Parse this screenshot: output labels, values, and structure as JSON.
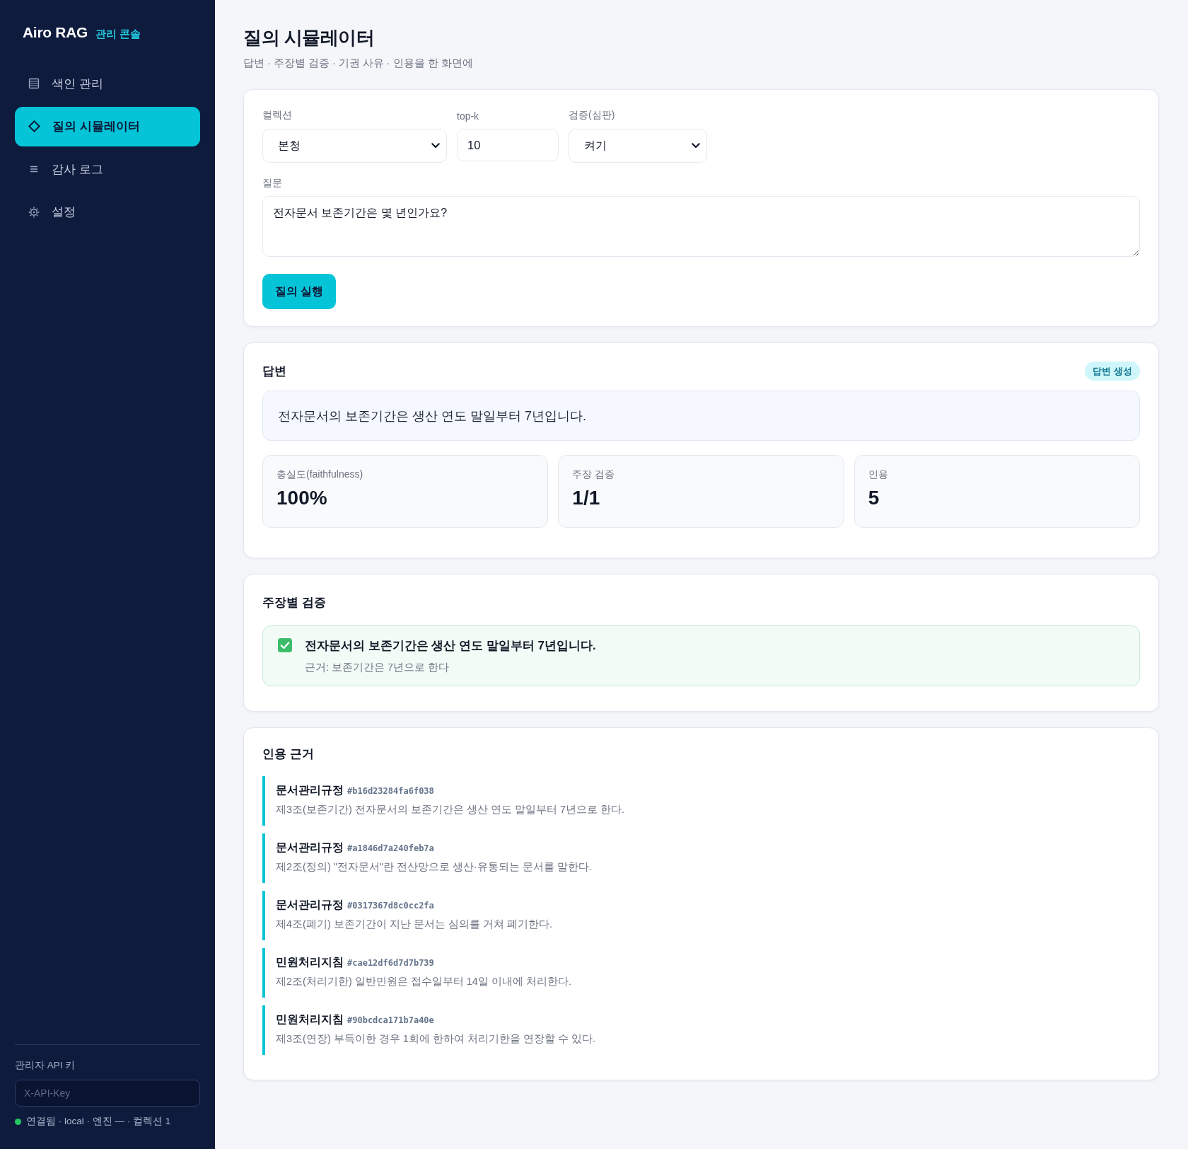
{
  "sidebar": {
    "logo": {
      "name": "Airo RAG",
      "tag": "관리 콘솔"
    },
    "nav": [
      {
        "label": "색인 관리",
        "selected": false
      },
      {
        "label": "질의 시뮬레이터",
        "selected": true
      },
      {
        "label": "감사 로그",
        "selected": false
      },
      {
        "label": "설정",
        "selected": false
      }
    ],
    "api_key": {
      "label": "관리자 API 키",
      "placeholder": "X-API-Key"
    },
    "status": {
      "connected": true,
      "text": "연결됨 · local · 엔진 — · 컬렉션 1"
    }
  },
  "page": {
    "title": "질의 시뮬레이터",
    "subtitle": "답변 · 주장별 검증 · 기권 사유 · 인용을 한 화면에"
  },
  "query_form": {
    "fields": [
      {
        "kind": "select",
        "label": "컬렉션",
        "value": "본청"
      },
      {
        "kind": "number",
        "label": "top-k",
        "value": "10"
      },
      {
        "kind": "select",
        "label": "검증(심판)",
        "value": "켜기"
      }
    ],
    "question": {
      "label": "질문",
      "value": "전자문서 보존기간은 몇 년인가요?"
    },
    "submit": "질의 실행"
  },
  "answer": {
    "heading": "답변",
    "badge": "답변 생성",
    "text": "전자문서의 보존기간은 생산 연도 말일부터 7년입니다.",
    "stats": [
      {
        "label": "충실도(faithfulness)",
        "value": "100%"
      },
      {
        "label": "주장 검증",
        "value": "1/1"
      },
      {
        "label": "인용",
        "value": "5"
      }
    ]
  },
  "claims": {
    "heading": "주장별 검증",
    "items": [
      {
        "verified": true,
        "text": "전자문서의 보존기간은 생산 연도 말일부터 7년입니다.",
        "evidence": "근거: 보존기간은 7년으로 한다"
      }
    ]
  },
  "citations": {
    "heading": "인용 근거",
    "items": [
      {
        "source": "문서관리규정",
        "hash": "#b16d23284fa6f038",
        "text": "제3조(보존기간) 전자문서의 보존기간은 생산 연도 말일부터 7년으로 한다."
      },
      {
        "source": "문서관리규정",
        "hash": "#a1846d7a240feb7a",
        "text": "제2조(정의) \"전자문서\"란 전산망으로 생산·유통되는 문서를 말한다."
      },
      {
        "source": "문서관리규정",
        "hash": "#0317367d8c0cc2fa",
        "text": "제4조(폐기) 보존기간이 지난 문서는 심의를 거쳐 폐기한다."
      },
      {
        "source": "민원처리지침",
        "hash": "#cae12df6d7d7b739",
        "text": "제2조(처리기한) 일반민원은 접수일부터 14일 이내에 처리한다."
      },
      {
        "source": "민원처리지침",
        "hash": "#90bcdca171b7a40e",
        "text": "제3조(연장) 부득이한 경우 1회에 한하여 처리기한을 연장할 수 있다."
      }
    ]
  }
}
